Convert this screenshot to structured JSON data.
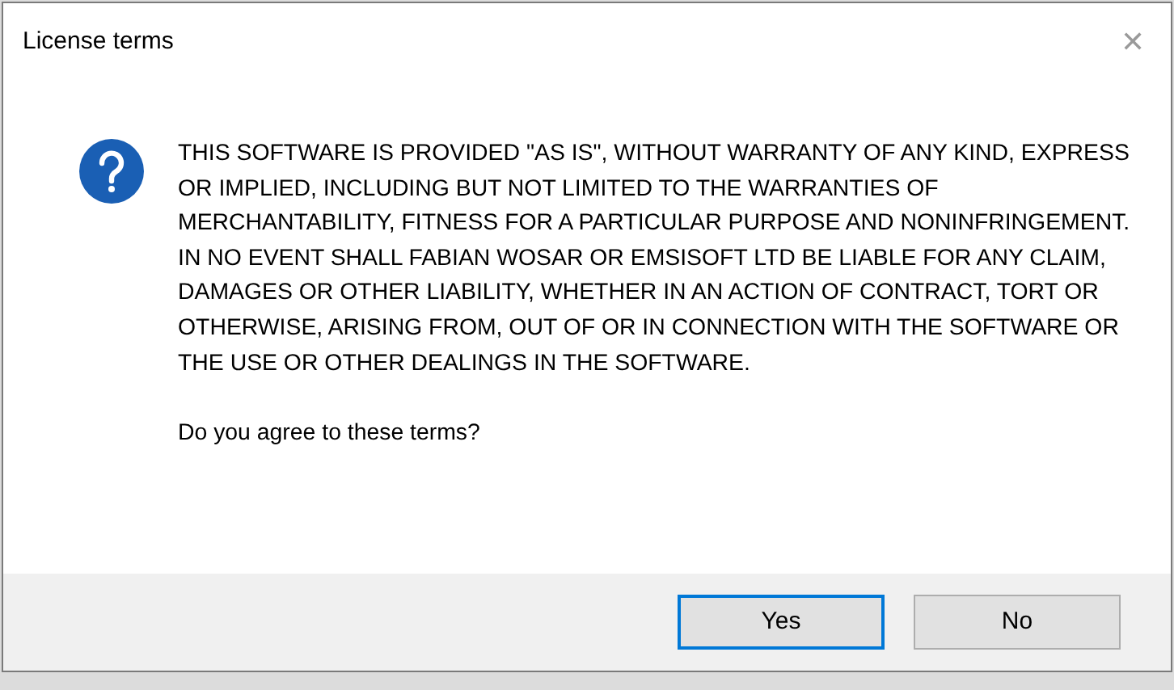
{
  "window": {
    "title": "License terms",
    "close": "✕"
  },
  "message": "THIS SOFTWARE IS PROVIDED \"AS IS\", WITHOUT WARRANTY OF ANY KIND, EXPRESS OR IMPLIED, INCLUDING BUT NOT LIMITED TO THE WARRANTIES OF MERCHANTABILITY, FITNESS FOR A PARTICULAR PURPOSE AND NONINFRINGEMENT. IN NO EVENT SHALL FABIAN WOSAR OR EMSISOFT LTD BE LIABLE FOR ANY CLAIM, DAMAGES OR OTHER LIABILITY, WHETHER IN AN ACTION OF CONTRACT, TORT OR OTHERWISE, ARISING FROM, OUT OF OR IN CONNECTION WITH THE SOFTWARE OR THE USE OR OTHER DEALINGS IN THE SOFTWARE.",
  "question": "Do you agree to these terms?",
  "buttons": [
    {
      "label": "Yes",
      "selected": true
    },
    {
      "label": "No",
      "selected": false
    }
  ]
}
